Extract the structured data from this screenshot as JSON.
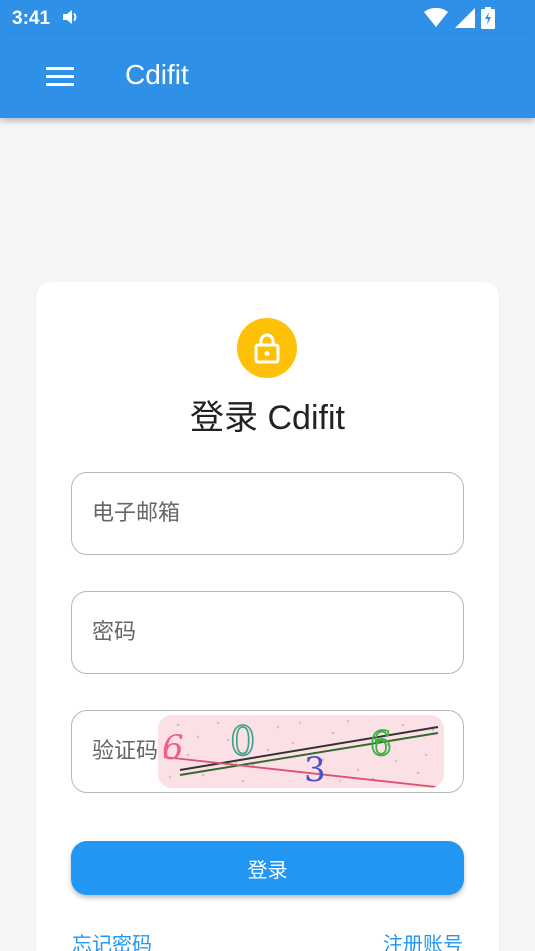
{
  "status_bar": {
    "time": "3:41",
    "sound_icon": "volume-icon",
    "wifi_icon": "wifi-icon",
    "signal_icon": "cell-signal-icon",
    "battery_icon": "battery-charging-icon"
  },
  "app_bar": {
    "title": "Cdifit",
    "menu_icon": "hamburger-menu-icon",
    "color": "#2f90e8"
  },
  "login_card": {
    "icon": "lock-icon",
    "icon_color": "#ffc107",
    "title": "登录 Cdifit",
    "email_placeholder": "电子邮箱",
    "email_value": "",
    "password_placeholder": "密码",
    "password_value": "",
    "captcha_placeholder": "验证码",
    "captcha_value": "",
    "captcha_chars": [
      "6",
      "0",
      "3",
      "6"
    ],
    "login_button": "登录",
    "forgot_password": "忘记密码",
    "register": "注册账号",
    "accent": "#2196f3"
  }
}
